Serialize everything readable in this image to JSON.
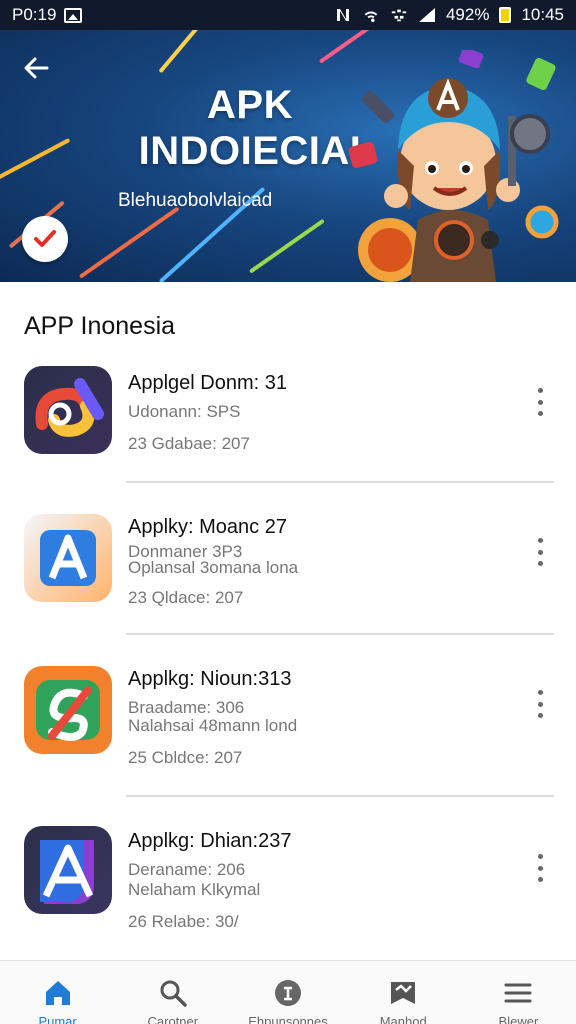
{
  "status_bar": {
    "left_text": "P0:19",
    "battery_percent": "492%",
    "time": "10:45",
    "icons": [
      "image-icon",
      "nfc-icon",
      "wifi-icon",
      "hotspot-icon",
      "signal-icon",
      "battery-icon"
    ]
  },
  "hero": {
    "title_line1": "APK",
    "title_line2": "INDOIECIAI",
    "subtitle": "Blehuaobolvlaicad",
    "back_icon": "arrow-left-icon",
    "badge_icon": "checkmark-icon"
  },
  "section": {
    "title": "APP Inonesia"
  },
  "apps": [
    {
      "name": "Applgel Donm: 31",
      "line1": "Udonann: SPS",
      "line2": "",
      "line3": "23 Gdabae: 207",
      "icon": "gradient-loop-icon"
    },
    {
      "name": "Applky: Moanc 27",
      "line1": "Donmaner 3P3",
      "line2": "Oplansal  3omana lona",
      "line3": "23 Qldace: 207",
      "icon": "letter-a-blue-icon"
    },
    {
      "name": "Applkg: Nioun:313",
      "line1": "Braadame: 306",
      "line2": "Nalahsai  48mann lond",
      "line3": "25 Cbldce: 207",
      "icon": "orange-green-s-icon"
    },
    {
      "name": "Applkg: Dhian:237",
      "line1": "Deraname: 206",
      "line2": "Nelaham  Klkymal",
      "line3": "26 Relabe: 30/",
      "icon": "letter-a-purple-icon"
    }
  ],
  "nav": {
    "items": [
      {
        "label": "Pumar",
        "icon": "home-icon",
        "active": true
      },
      {
        "label": "Carotner",
        "icon": "search-icon",
        "active": false
      },
      {
        "label": "Ehpunsonnes",
        "icon": "info-icon",
        "active": false
      },
      {
        "label": "Manhod",
        "icon": "map-icon",
        "active": false
      },
      {
        "label": "Blewer",
        "icon": "menu-icon",
        "active": false
      }
    ]
  },
  "colors": {
    "accent": "#1f7bd4",
    "hero_dark": "#0d2a55",
    "hero_light": "#2a6fb5",
    "check_red": "#e0302a"
  }
}
